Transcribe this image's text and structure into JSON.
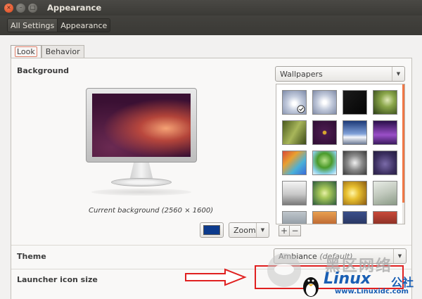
{
  "window": {
    "title": "Appearance",
    "close_glyph": "×",
    "min_glyph": "–",
    "max_glyph": "□"
  },
  "toolbar": {
    "crumbs": [
      "All Settings",
      "Appearance"
    ]
  },
  "tabs": [
    "Look",
    "Behavior"
  ],
  "background": {
    "label": "Background",
    "caption": "Current background (2560 × 1600)",
    "color_button_color": "#0c3a8c",
    "mode_combo": "Zoom",
    "source_combo": "Wallpapers",
    "add_label": "+",
    "remove_label": "−"
  },
  "theme": {
    "label": "Theme",
    "value": "Ambiance",
    "value_suffix": "(default)"
  },
  "launcher": {
    "label": "Launcher icon size"
  },
  "watermark": {
    "text_cn": "黑区网络",
    "text_site": "Linux",
    "text_suffix": "公社",
    "url": "www.Linuxidc.com"
  },
  "colors": {
    "accent": "#f07746",
    "titlebar": "#3b3a36",
    "annotation_red": "#e02020"
  }
}
